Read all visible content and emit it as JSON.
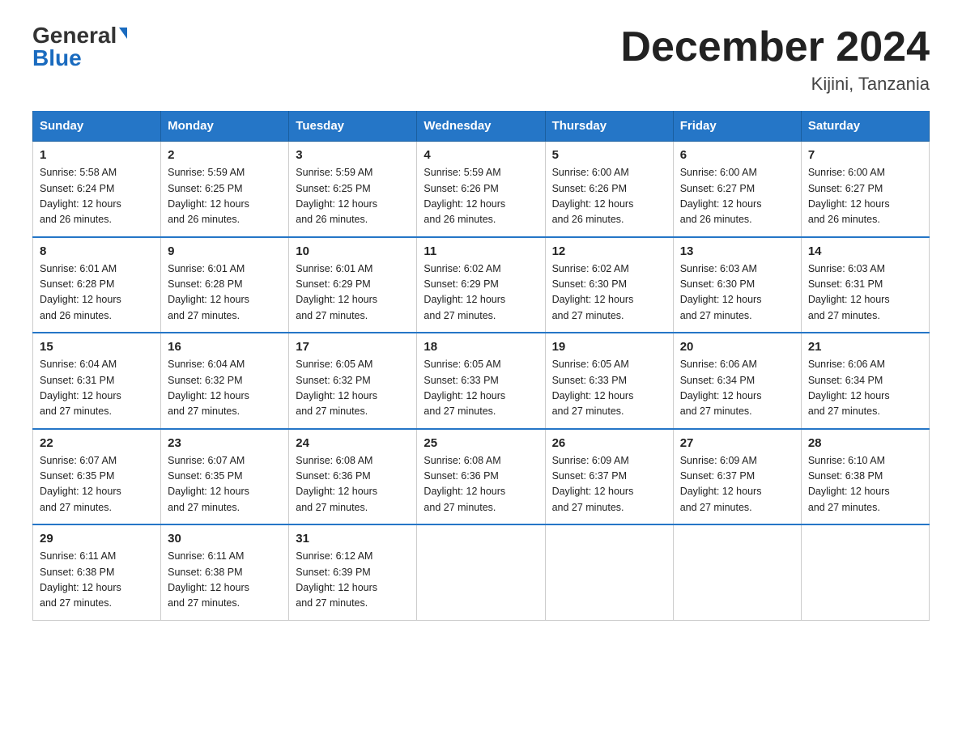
{
  "logo": {
    "general": "General",
    "blue": "Blue"
  },
  "header": {
    "title": "December 2024",
    "location": "Kijini, Tanzania"
  },
  "days_of_week": [
    "Sunday",
    "Monday",
    "Tuesday",
    "Wednesday",
    "Thursday",
    "Friday",
    "Saturday"
  ],
  "weeks": [
    [
      {
        "day": "1",
        "sunrise": "5:58 AM",
        "sunset": "6:24 PM",
        "daylight": "12 hours and 26 minutes."
      },
      {
        "day": "2",
        "sunrise": "5:59 AM",
        "sunset": "6:25 PM",
        "daylight": "12 hours and 26 minutes."
      },
      {
        "day": "3",
        "sunrise": "5:59 AM",
        "sunset": "6:25 PM",
        "daylight": "12 hours and 26 minutes."
      },
      {
        "day": "4",
        "sunrise": "5:59 AM",
        "sunset": "6:26 PM",
        "daylight": "12 hours and 26 minutes."
      },
      {
        "day": "5",
        "sunrise": "6:00 AM",
        "sunset": "6:26 PM",
        "daylight": "12 hours and 26 minutes."
      },
      {
        "day": "6",
        "sunrise": "6:00 AM",
        "sunset": "6:27 PM",
        "daylight": "12 hours and 26 minutes."
      },
      {
        "day": "7",
        "sunrise": "6:00 AM",
        "sunset": "6:27 PM",
        "daylight": "12 hours and 26 minutes."
      }
    ],
    [
      {
        "day": "8",
        "sunrise": "6:01 AM",
        "sunset": "6:28 PM",
        "daylight": "12 hours and 26 minutes."
      },
      {
        "day": "9",
        "sunrise": "6:01 AM",
        "sunset": "6:28 PM",
        "daylight": "12 hours and 27 minutes."
      },
      {
        "day": "10",
        "sunrise": "6:01 AM",
        "sunset": "6:29 PM",
        "daylight": "12 hours and 27 minutes."
      },
      {
        "day": "11",
        "sunrise": "6:02 AM",
        "sunset": "6:29 PM",
        "daylight": "12 hours and 27 minutes."
      },
      {
        "day": "12",
        "sunrise": "6:02 AM",
        "sunset": "6:30 PM",
        "daylight": "12 hours and 27 minutes."
      },
      {
        "day": "13",
        "sunrise": "6:03 AM",
        "sunset": "6:30 PM",
        "daylight": "12 hours and 27 minutes."
      },
      {
        "day": "14",
        "sunrise": "6:03 AM",
        "sunset": "6:31 PM",
        "daylight": "12 hours and 27 minutes."
      }
    ],
    [
      {
        "day": "15",
        "sunrise": "6:04 AM",
        "sunset": "6:31 PM",
        "daylight": "12 hours and 27 minutes."
      },
      {
        "day": "16",
        "sunrise": "6:04 AM",
        "sunset": "6:32 PM",
        "daylight": "12 hours and 27 minutes."
      },
      {
        "day": "17",
        "sunrise": "6:05 AM",
        "sunset": "6:32 PM",
        "daylight": "12 hours and 27 minutes."
      },
      {
        "day": "18",
        "sunrise": "6:05 AM",
        "sunset": "6:33 PM",
        "daylight": "12 hours and 27 minutes."
      },
      {
        "day": "19",
        "sunrise": "6:05 AM",
        "sunset": "6:33 PM",
        "daylight": "12 hours and 27 minutes."
      },
      {
        "day": "20",
        "sunrise": "6:06 AM",
        "sunset": "6:34 PM",
        "daylight": "12 hours and 27 minutes."
      },
      {
        "day": "21",
        "sunrise": "6:06 AM",
        "sunset": "6:34 PM",
        "daylight": "12 hours and 27 minutes."
      }
    ],
    [
      {
        "day": "22",
        "sunrise": "6:07 AM",
        "sunset": "6:35 PM",
        "daylight": "12 hours and 27 minutes."
      },
      {
        "day": "23",
        "sunrise": "6:07 AM",
        "sunset": "6:35 PM",
        "daylight": "12 hours and 27 minutes."
      },
      {
        "day": "24",
        "sunrise": "6:08 AM",
        "sunset": "6:36 PM",
        "daylight": "12 hours and 27 minutes."
      },
      {
        "day": "25",
        "sunrise": "6:08 AM",
        "sunset": "6:36 PM",
        "daylight": "12 hours and 27 minutes."
      },
      {
        "day": "26",
        "sunrise": "6:09 AM",
        "sunset": "6:37 PM",
        "daylight": "12 hours and 27 minutes."
      },
      {
        "day": "27",
        "sunrise": "6:09 AM",
        "sunset": "6:37 PM",
        "daylight": "12 hours and 27 minutes."
      },
      {
        "day": "28",
        "sunrise": "6:10 AM",
        "sunset": "6:38 PM",
        "daylight": "12 hours and 27 minutes."
      }
    ],
    [
      {
        "day": "29",
        "sunrise": "6:11 AM",
        "sunset": "6:38 PM",
        "daylight": "12 hours and 27 minutes."
      },
      {
        "day": "30",
        "sunrise": "6:11 AM",
        "sunset": "6:38 PM",
        "daylight": "12 hours and 27 minutes."
      },
      {
        "day": "31",
        "sunrise": "6:12 AM",
        "sunset": "6:39 PM",
        "daylight": "12 hours and 27 minutes."
      },
      null,
      null,
      null,
      null
    ]
  ]
}
